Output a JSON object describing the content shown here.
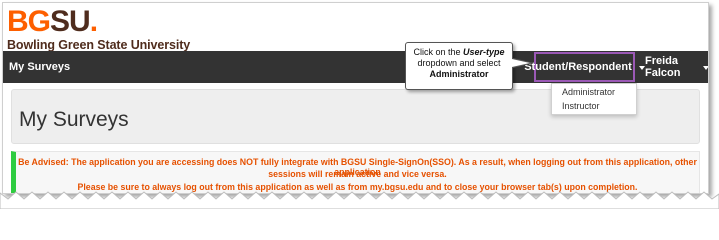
{
  "logo": {
    "mark_bg": "BG",
    "mark_su": "SU",
    "mark_dot": ".",
    "name": "Bowling Green State University"
  },
  "navbar": {
    "brand": "My Surveys",
    "role_label": "Student/Respondent",
    "user_label": "Freida Falcon"
  },
  "dropdown": {
    "items": [
      "Administrator",
      "Instructor"
    ]
  },
  "callout": {
    "prefix": "Click on the ",
    "emphasis": "User-type",
    "middle": "dropdown and select",
    "target": "Administrator"
  },
  "page": {
    "title": "My Surveys"
  },
  "alert": {
    "line1": "Be Advised: The application you are accessing does NOT fully integrate with BGSU Single-SignOn(SSO). As a result, when logging out from this application, other application",
    "line2": "sessions will remain active and vice versa.",
    "line3": "Please be sure to always log out from this application as well as from my.bgsu.edu and to close your browser tab(s) upon completion."
  },
  "colors": {
    "navbar": "#333333",
    "brand_orange": "#fd5f00",
    "brand_brown": "#4f2c1d",
    "highlight": "#9b59b6",
    "alert_text": "#e65100",
    "alert_accent": "#2ecc40"
  }
}
